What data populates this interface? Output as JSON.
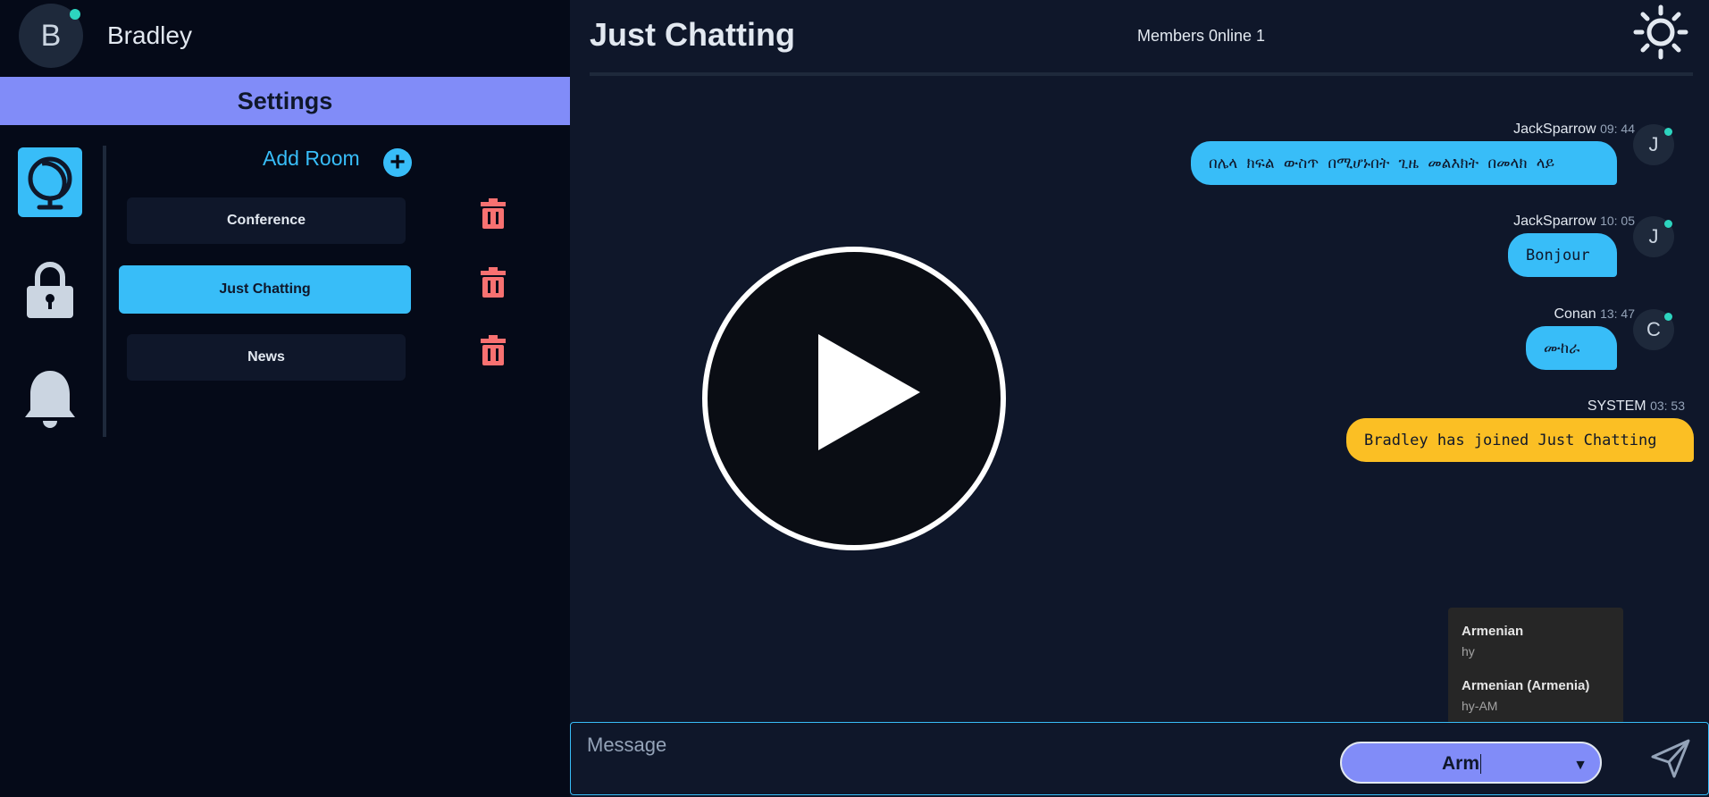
{
  "user": {
    "initial": "B",
    "name": "Bradley"
  },
  "sidebar": {
    "settings_title": "Settings",
    "add_room_label": "Add Room",
    "add_room_symbol": "+",
    "rooms": [
      {
        "label": "Conference",
        "active": false
      },
      {
        "label": "Just Chatting",
        "active": true
      },
      {
        "label": "News",
        "active": false
      }
    ],
    "nav_icons": [
      "globe-icon",
      "lock-icon",
      "bell-icon"
    ]
  },
  "chat": {
    "room_title": "Just Chatting",
    "members_online": "Members 0nline 1",
    "theme_icon": "sun-icon",
    "messages": [
      {
        "author": "JackSparrow",
        "time": "09: 44",
        "text": "በሌላ ክፍል ውስጥ በሚሆኑበት ጊዜ መልእክት በመላክ ላይ",
        "avatar": "J",
        "color": "blue"
      },
      {
        "author": "JackSparrow",
        "time": "10: 05",
        "text": "Bonjour",
        "avatar": "J",
        "color": "blue"
      },
      {
        "author": "Conan",
        "time": "13: 47",
        "text": "ሙከራ",
        "avatar": "C",
        "color": "blue"
      },
      {
        "author": "SYSTEM",
        "time": "03: 53",
        "text": "Bradley has joined Just Chatting",
        "avatar": "",
        "color": "yellow"
      }
    ]
  },
  "composer": {
    "placeholder": "Message",
    "language_value": "Arm",
    "dropdown_arrow": "▼",
    "language_options": [
      {
        "name": "Armenian",
        "code": "hy"
      },
      {
        "name": "Armenian (Armenia)",
        "code": "hy-AM"
      }
    ]
  },
  "colors": {
    "accent_blue": "#38bdf8",
    "accent_purple": "#818cf8",
    "system_yellow": "#fbbf24",
    "trash_red": "#f87171",
    "online_teal": "#2dd4bf"
  }
}
